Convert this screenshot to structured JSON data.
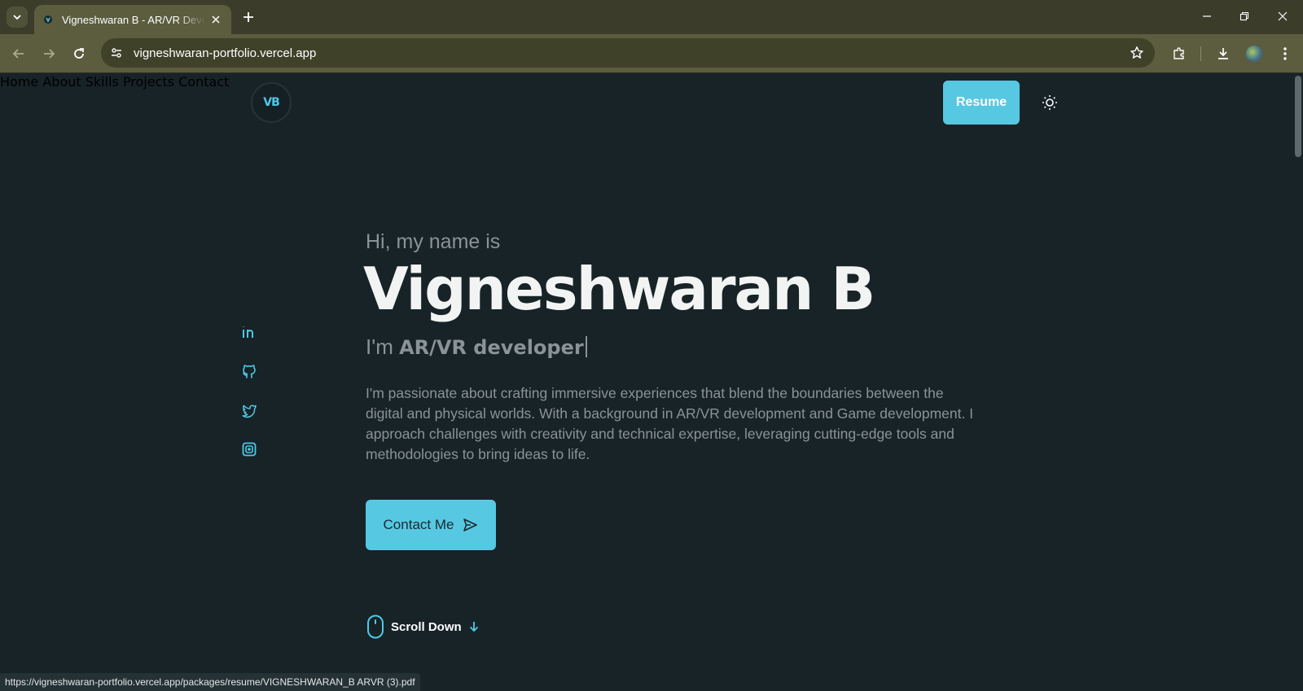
{
  "browser": {
    "tab_title": "Vigneshwaran B - AR/VR Developer",
    "url": "vigneshwaran-portfolio.vercel.app",
    "status_url": "https://vigneshwaran-portfolio.vercel.app/packages/resume/VIGNESHWARAN_B ARVR (3).pdf"
  },
  "site": {
    "logo_text": "VB",
    "nav": {
      "home": "Home",
      "about": "About",
      "skills": "Skills",
      "projects": "Projects",
      "contact": "Contact",
      "resume": "Resume"
    },
    "social_icons": [
      "linkedin-icon",
      "github-icon",
      "twitter-icon",
      "instagram-icon"
    ]
  },
  "hero": {
    "greeting": "Hi, my name is",
    "name": "Vigneshwaran B",
    "role_prefix": "I'm ",
    "role": "AR/VR developer",
    "bio": "I'm passionate about crafting immersive experiences that blend the boundaries between the digital and physical worlds. With a background in AR/VR development and Game development. I approach challenges with creativity and technical expertise, leveraging cutting-edge tools and methodologies to bring ideas to life.",
    "contact_button": "Contact Me",
    "scroll_down": "Scroll Down"
  },
  "colors": {
    "accent": "#57c8e1",
    "background": "#172327",
    "muted_text": "#8a9396"
  }
}
